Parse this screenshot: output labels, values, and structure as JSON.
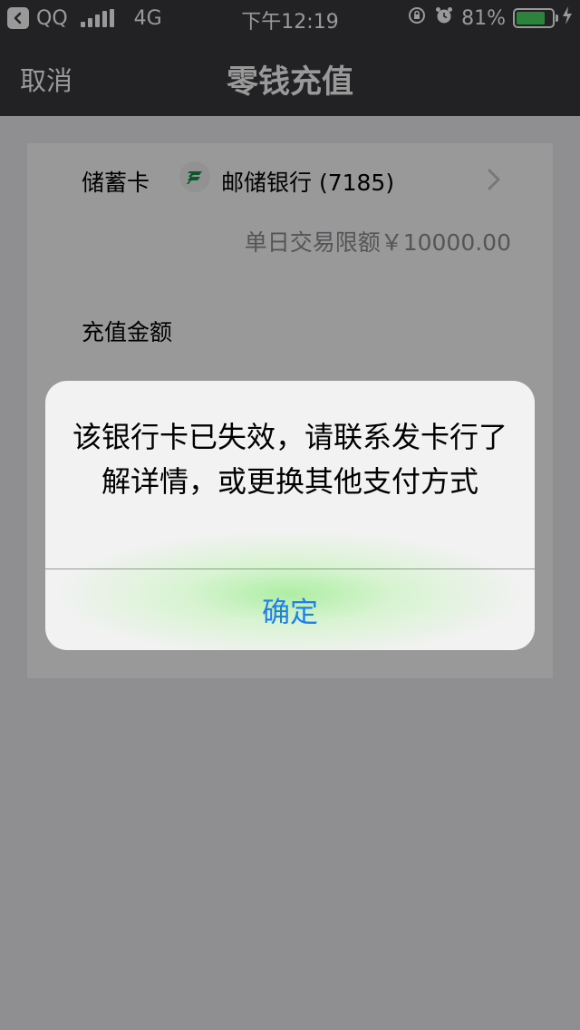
{
  "status_bar": {
    "carrier_back": "QQ",
    "network": "4G",
    "time": "下午12:19",
    "battery_percent": "81%",
    "battery_level": 0.81,
    "icons": [
      "back-arrow-icon",
      "signal-icon",
      "rotation-lock-icon",
      "alarm-icon",
      "battery-icon",
      "charging-bolt-icon"
    ]
  },
  "nav": {
    "cancel_label": "取消",
    "title": "零钱充值"
  },
  "card": {
    "type_label": "储蓄卡",
    "bank_logo_icon": "postal-bank-logo-icon",
    "bank_name": "邮储银行 (7185)",
    "daily_limit": "单日交易限额￥10000.00",
    "amount_label": "充值金额"
  },
  "alert": {
    "message": "该银行卡已失效，请联系发卡行了解详情，或更换其他支付方式",
    "confirm_label": "确定"
  },
  "colors": {
    "nav_bg": "#393a3f",
    "battery_green": "#4cd964",
    "button_blue": "#1e7ff0",
    "bank_green": "#16914a"
  }
}
